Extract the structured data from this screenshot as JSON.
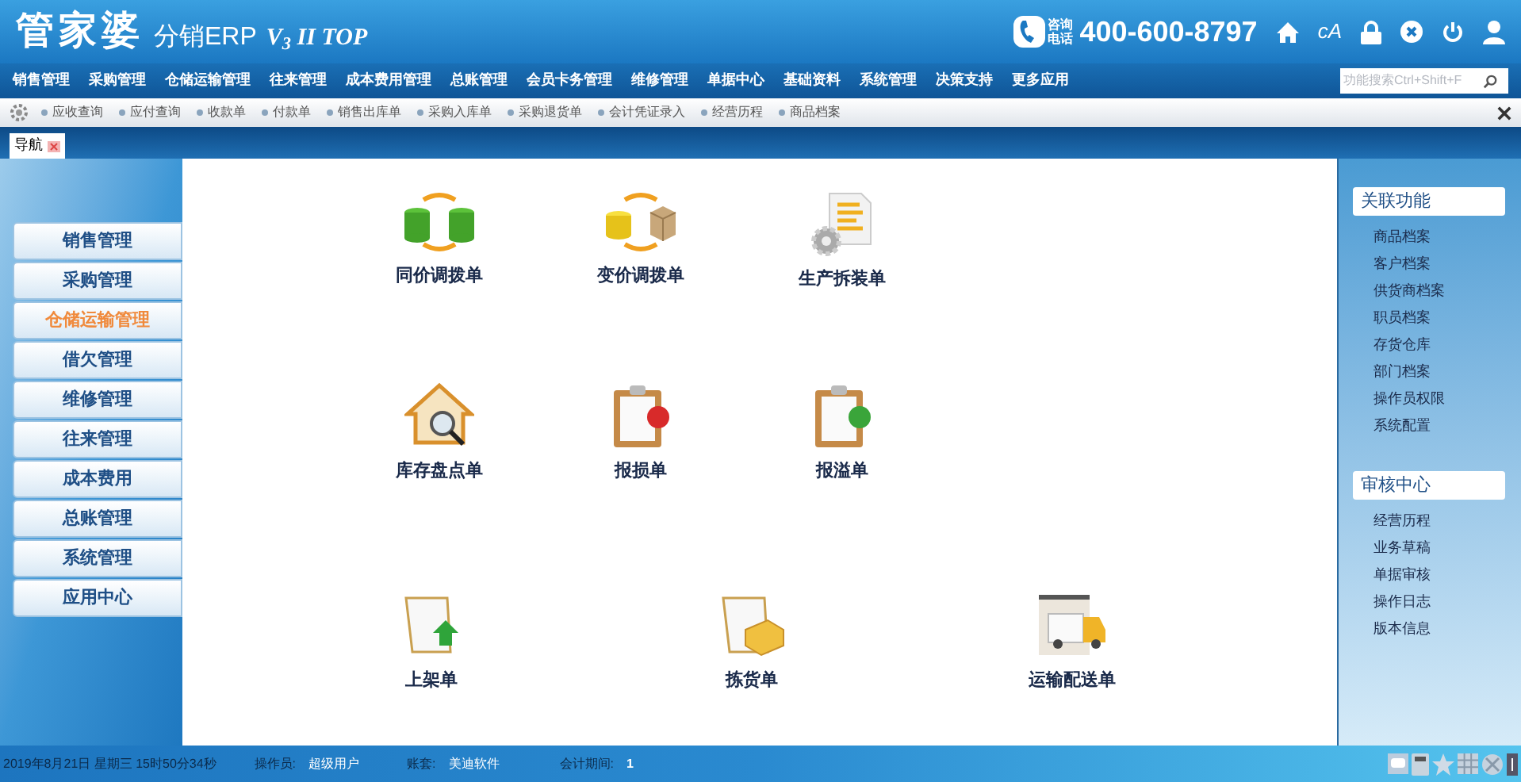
{
  "header": {
    "logo_main": "管家婆",
    "logo_product": "分销ERP",
    "logo_version": "V$_{3}$ II TOP",
    "hotline_label_1": "咨询",
    "hotline_label_2": "电话",
    "hotline": "400-600-8797",
    "font_button": "cA"
  },
  "menu": [
    "销售管理",
    "采购管理",
    "仓储运输管理",
    "往来管理",
    "成本费用管理",
    "总账管理",
    "会员卡务管理",
    "维修管理",
    "单据中心",
    "基础资料",
    "系统管理",
    "决策支持",
    "更多应用"
  ],
  "search": {
    "placeholder": "功能搜索Ctrl+Shift+F"
  },
  "quick_links": [
    "应收查询",
    "应付查询",
    "收款单",
    "付款单",
    "销售出库单",
    "采购入库单",
    "采购退货单",
    "会计凭证录入",
    "经营历程",
    "商品档案"
  ],
  "tabs": [
    {
      "label": "导航",
      "selected": true
    }
  ],
  "sidebar": {
    "items": [
      {
        "label": "销售管理",
        "selected": false
      },
      {
        "label": "采购管理",
        "selected": false
      },
      {
        "label": "仓储运输管理",
        "selected": true
      },
      {
        "label": "借欠管理",
        "selected": false
      },
      {
        "label": "维修管理",
        "selected": false
      },
      {
        "label": "往来管理",
        "selected": false
      },
      {
        "label": "成本费用",
        "selected": false
      },
      {
        "label": "总账管理",
        "selected": false
      },
      {
        "label": "系统管理",
        "selected": false
      },
      {
        "label": "应用中心",
        "selected": false
      }
    ]
  },
  "documents": [
    [
      {
        "label": "同价调拨单",
        "kind": "swap-money"
      },
      {
        "label": "变价调拨单",
        "kind": "swap-goods"
      },
      {
        "label": "生产拆装单",
        "kind": "assembly"
      }
    ],
    [
      {
        "label": "库存盘点单",
        "kind": "stocktake"
      },
      {
        "label": "报损单",
        "kind": "loss"
      },
      {
        "label": "报溢单",
        "kind": "overflow"
      }
    ],
    [
      {
        "label": "上架单",
        "kind": "shelve"
      },
      {
        "label": "拣货单",
        "kind": "pick"
      },
      {
        "label": "运输配送单",
        "kind": "delivery"
      }
    ]
  ],
  "right_panel": [
    {
      "title": "关联功能",
      "items": [
        "商品档案",
        "客户档案",
        "供货商档案",
        "职员档案",
        "存货仓库",
        "部门档案",
        "操作员权限",
        "系统配置"
      ]
    },
    {
      "title": "审核中心",
      "items": [
        "经营历程",
        "业务草稿",
        "单据审核",
        "操作日志",
        "版本信息"
      ]
    }
  ],
  "status_bar": {
    "datetime": "2019年8月21日 星期三 15时50分34秒",
    "operator_label": "操作员:",
    "operator": "超级用户",
    "account_label": "账套:",
    "account": "美迪软件",
    "period_label": "会计期间:",
    "period": "1"
  }
}
